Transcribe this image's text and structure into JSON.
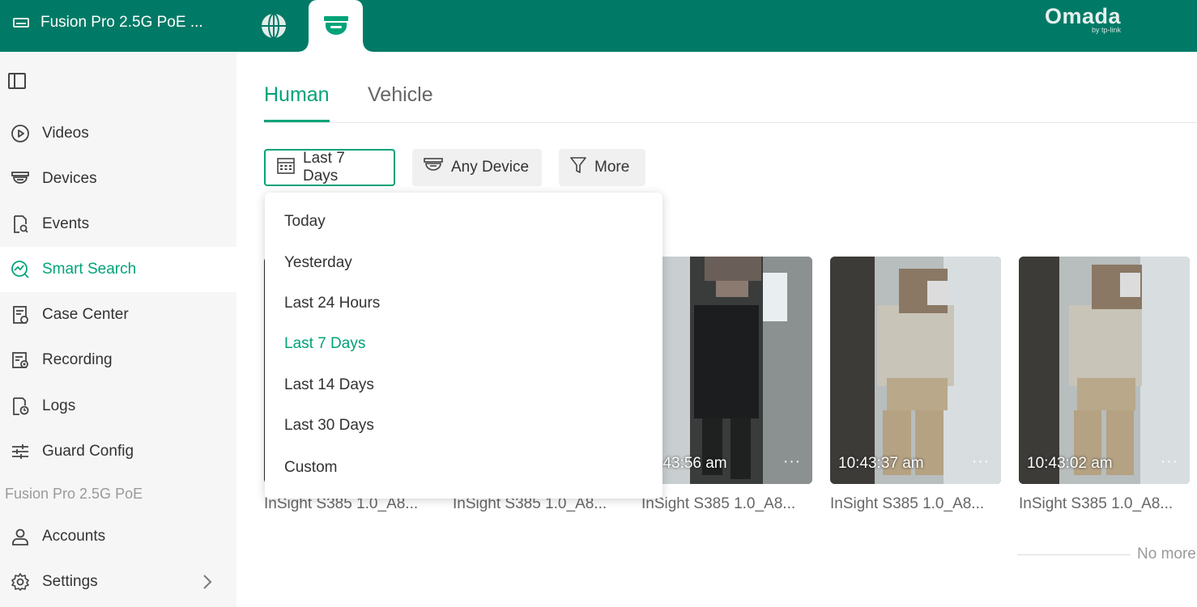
{
  "topbar": {
    "site_name": "Fusion Pro 2.5G PoE ...",
    "brand_name": "Omada",
    "brand_sub": "by tp-link",
    "bg_color": "#007a66"
  },
  "sidebar": {
    "items": [
      {
        "label": "Videos",
        "icon": "play-circle-icon"
      },
      {
        "label": "Devices",
        "icon": "camera-dome-icon"
      },
      {
        "label": "Events",
        "icon": "event-search-icon"
      },
      {
        "label": "Smart Search",
        "icon": "smart-search-icon",
        "active": true
      },
      {
        "label": "Case Center",
        "icon": "case-icon"
      },
      {
        "label": "Recording",
        "icon": "recording-icon"
      },
      {
        "label": "Logs",
        "icon": "logs-icon"
      },
      {
        "label": "Guard Config",
        "icon": "sliders-icon"
      }
    ],
    "section_label": "Fusion Pro 2.5G PoE",
    "bottom_items": [
      {
        "label": "Accounts",
        "icon": "user-icon"
      },
      {
        "label": "Settings",
        "icon": "gear-icon"
      }
    ]
  },
  "tabs": [
    {
      "label": "Human",
      "active": true
    },
    {
      "label": "Vehicle",
      "active": false
    }
  ],
  "filters": {
    "date": "Last 7 Days",
    "device": "Any Device",
    "more": "More"
  },
  "dropdown": {
    "options": [
      "Today",
      "Yesterday",
      "Last 24 Hours",
      "Last 7 Days",
      "Last 14 Days",
      "Last 30 Days",
      "Custom"
    ],
    "selected": "Last 7 Days"
  },
  "results": [
    {
      "time": "",
      "camera": "InSight S385 1.0_A8..."
    },
    {
      "time": "",
      "camera": "InSight S385 1.0_A8..."
    },
    {
      "time": "10:43:56 am",
      "camera": "InSight S385 1.0_A8..."
    },
    {
      "time": "10:43:37 am",
      "camera": "InSight S385 1.0_A8..."
    },
    {
      "time": "10:43:02 am",
      "camera": "InSight S385 1.0_A8..."
    }
  ],
  "footer_text": "No more",
  "accent_color": "#00a378"
}
